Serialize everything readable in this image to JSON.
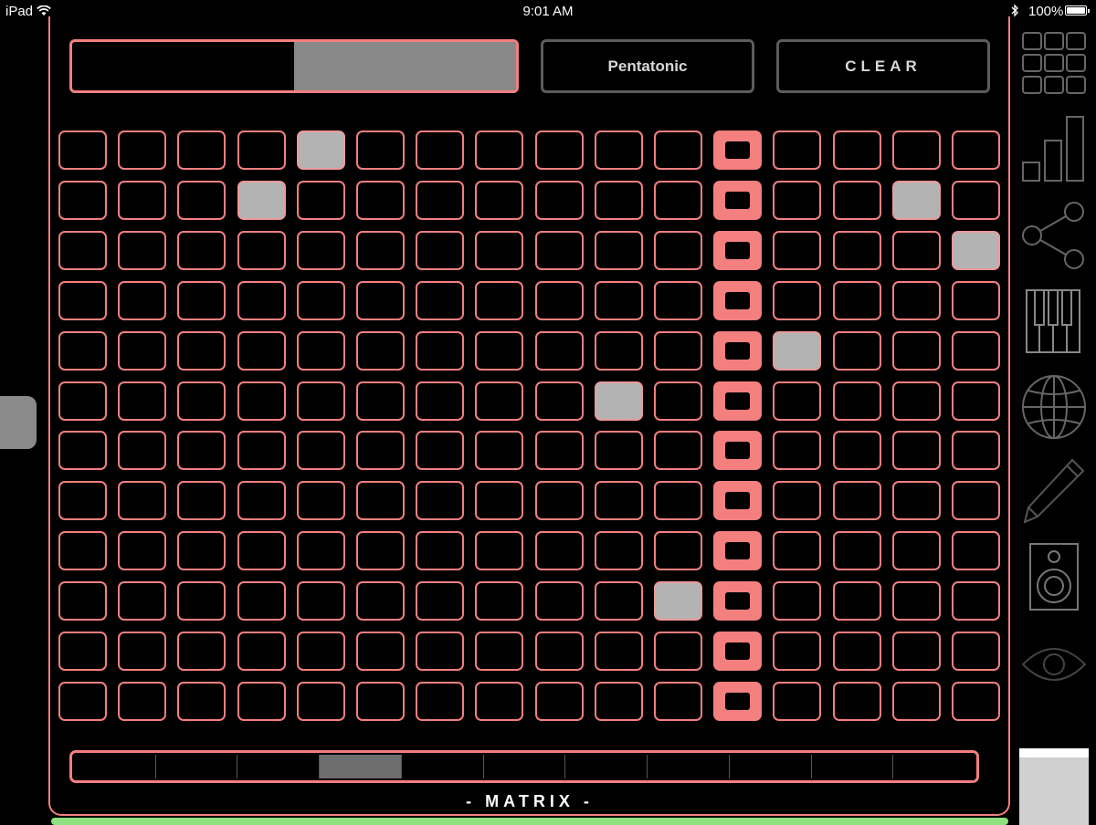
{
  "status_bar": {
    "carrier": "iPad",
    "time": "9:01 AM",
    "battery": "100%"
  },
  "controls": {
    "slider_value": 0.5,
    "scale_label": "Pentatonic",
    "clear_label": "CLEAR"
  },
  "grid": {
    "rows": 12,
    "cols": 16,
    "playhead_col": 11,
    "active_cells": [
      [
        0,
        4
      ],
      [
        1,
        3
      ],
      [
        1,
        14
      ],
      [
        2,
        15
      ],
      [
        4,
        12
      ],
      [
        5,
        9
      ],
      [
        9,
        10
      ]
    ]
  },
  "pages": {
    "count": 11,
    "active_index": 3
  },
  "footer_label": "- MATRIX -",
  "sidebar": {
    "icons": [
      "grid-icon",
      "bar-chart-icon",
      "share-icon",
      "piano-icon",
      "globe-icon",
      "pencil-icon",
      "speaker-icon",
      "eye-icon"
    ]
  },
  "colors": {
    "accent": "#f37f7f",
    "active_cell": "#b3b3b3",
    "muted_button": "#5c5c5c",
    "indicator_green": "#8fe07f"
  }
}
